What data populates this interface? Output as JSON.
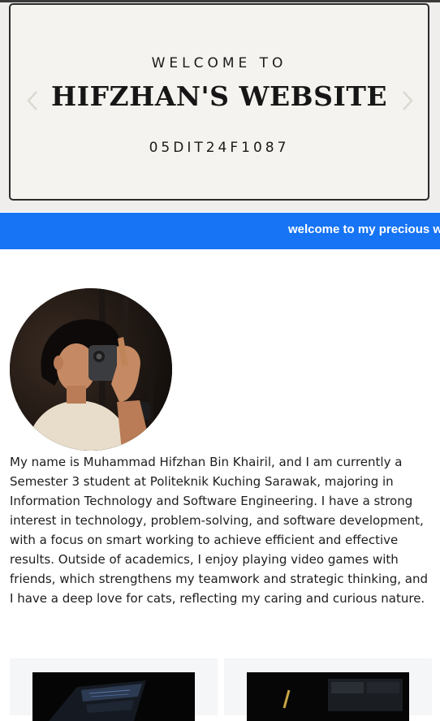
{
  "hero": {
    "welcome": "WELCOME TO",
    "title": "HIFZHAN'S WEBSITE",
    "code": "05DIT24F1087",
    "prev_icon": "chevron-left-icon",
    "next_icon": "chevron-right-icon"
  },
  "marquee": {
    "text": "welcome to my precious w"
  },
  "profile": {
    "avatar_icon": "profile-photo",
    "about": "My name is Muhammad Hifzhan Bin Khairil, and I am currently a Semester 3 student at Politeknik Kuching Sarawak, majoring in Information Technology and Software Engineering. I have a strong interest in technology, problem-solving, and software development, with a focus on smart working to achieve efficient and effective results. Outside of academics, I enjoy playing video games with friends, which strengthens my teamwork and strategic thinking, and I have a deep love for cats, reflecting my caring and curious nature."
  },
  "colors": {
    "marquee_bg": "#1674f5",
    "hero_bg": "#f5f3ef"
  }
}
